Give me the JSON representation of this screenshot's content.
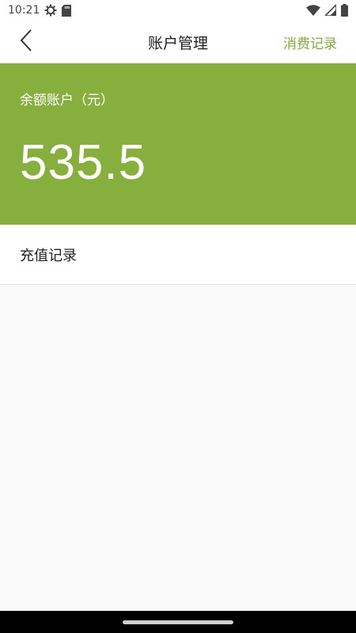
{
  "status_bar": {
    "time": "10:21",
    "icons_left": [
      "settings-gear-icon",
      "sd-card-icon"
    ],
    "icons_right": [
      "wifi-icon",
      "cellular-signal-icon",
      "battery-icon"
    ]
  },
  "nav": {
    "back_icon": "chevron-left-icon",
    "title": "账户管理",
    "action_label": "消费记录"
  },
  "balance": {
    "label": "余额账户（元）",
    "value": "535.5"
  },
  "list": {
    "items": [
      {
        "label": "充值记录"
      }
    ]
  },
  "colors": {
    "accent": "#86af3e",
    "accent_text": "#7fab3c",
    "background": "#fafafa"
  }
}
